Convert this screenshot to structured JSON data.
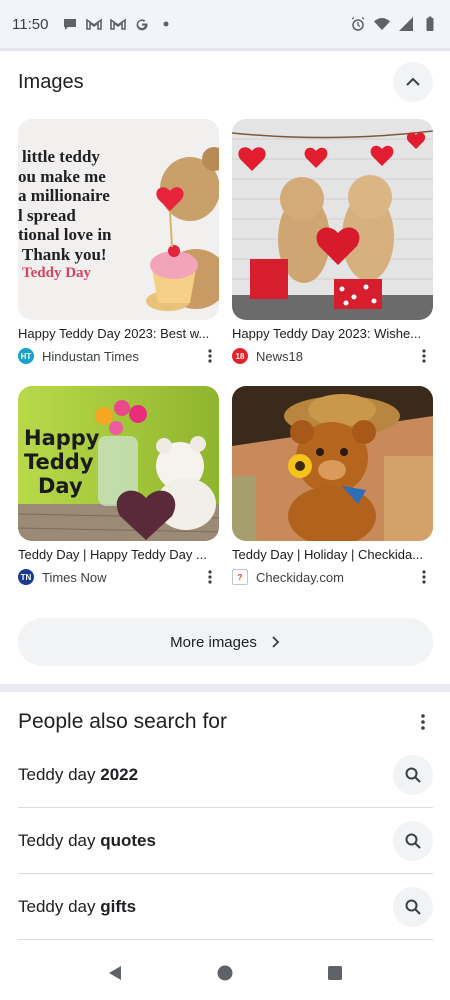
{
  "status_bar": {
    "time": "11:50",
    "left_icons": [
      "chat-bubble-icon",
      "gmail-icon",
      "gmail-icon",
      "google-icon",
      "dot-icon"
    ],
    "right_icons": [
      "alarm-icon",
      "wifi-icon",
      "signal-icon",
      "battery-icon"
    ]
  },
  "images_section": {
    "title": "Images",
    "cards": [
      {
        "title": "Happy Teddy Day 2023: Best w...",
        "source": "Hindustan Times",
        "source_logo_text": "HT",
        "source_color": "#1aa3c8",
        "thumb_text": [
          "little teddy",
          "ou make me",
          "a millionaire",
          "l spread",
          "tional love in",
          "Thank you!",
          "Teddy Day"
        ]
      },
      {
        "title": "Happy Teddy Day 2023: Wishe...",
        "source": "News18",
        "source_logo_text": "18",
        "source_color": "#e8202a"
      },
      {
        "title": "Teddy Day | Happy Teddy Day ...",
        "source": "Times Now",
        "source_logo_text": "TN",
        "source_color": "#1a3a8f",
        "thumb_text": [
          "Happy",
          "Teddy",
          "Day"
        ]
      },
      {
        "title": "Teddy Day | Holiday | Checkida...",
        "source": "Checkiday.com",
        "source_logo_text": "?",
        "source_color": "#d93025"
      }
    ],
    "more_button": "More images"
  },
  "people_also_search": {
    "title": "People also search for",
    "items": [
      {
        "prefix": "Teddy day ",
        "bold": "2022"
      },
      {
        "prefix": "Teddy day ",
        "bold": "quotes"
      },
      {
        "prefix": "Teddy day ",
        "bold": "gifts"
      }
    ]
  },
  "nav_bar": {
    "icons": [
      "back-icon",
      "home-icon",
      "recents-icon"
    ]
  }
}
